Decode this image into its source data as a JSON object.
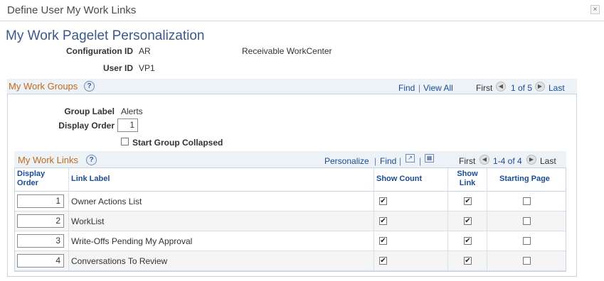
{
  "window": {
    "title": "Define User My Work Links",
    "close": "×"
  },
  "page_title": "My Work Pagelet Personalization",
  "config": {
    "configuration_id_label": "Configuration ID",
    "configuration_id_value": "AR",
    "configuration_desc": "Receivable WorkCenter",
    "user_id_label": "User ID",
    "user_id_value": "VP1"
  },
  "work_groups": {
    "title": "My Work Groups",
    "help": "?",
    "find": "Find",
    "sep": "|",
    "view_all": "View All",
    "first": "First",
    "prev_icon": "◀",
    "count": "1 of 5",
    "next_icon": "▶",
    "last": "Last",
    "group_label_label": "Group Label",
    "group_label_value": "Alerts",
    "display_order_label": "Display Order",
    "display_order_value": "1",
    "start_collapsed_label": "Start Group Collapsed",
    "start_collapsed_checked": false
  },
  "work_links": {
    "title": "My Work Links",
    "help": "?",
    "personalize": "Personalize",
    "find": "Find",
    "sep": "|",
    "first": "First",
    "count": "1-4 of 4",
    "last": "Last",
    "columns": {
      "display_order_1": "Display",
      "display_order_2": "Order",
      "link_label": "Link Label",
      "show_count": "Show Count",
      "show_link_1": "Show",
      "show_link_2": "Link",
      "starting_page": "Starting Page"
    },
    "rows": [
      {
        "order": "1",
        "label": "Owner Actions List",
        "show_count": "✔",
        "show_link": "✔",
        "starting_page": ""
      },
      {
        "order": "2",
        "label": "WorkList",
        "show_count": "✔",
        "show_link": "✔",
        "starting_page": ""
      },
      {
        "order": "3",
        "label": "Write-Offs Pending My Approval",
        "show_count": "✔",
        "show_link": "✔",
        "starting_page": ""
      },
      {
        "order": "4",
        "label": "Conversations To Review",
        "show_count": "✔",
        "show_link": "✔",
        "starting_page": ""
      }
    ]
  }
}
